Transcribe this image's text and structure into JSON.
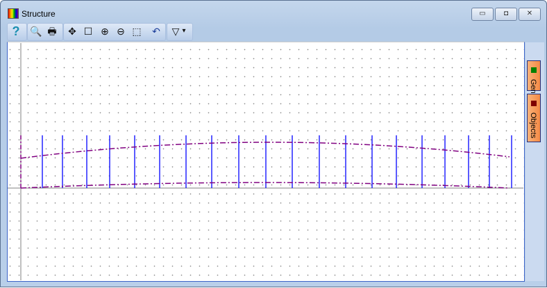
{
  "window": {
    "title": "Structure",
    "minimize": "▭",
    "maximize": "◘",
    "close": "✕"
  },
  "toolbar": {
    "help": "?",
    "preview": "🔍",
    "print": "🖶",
    "pan": "✥",
    "select": "☐",
    "zoom_in": "⊕",
    "zoom_out": "⊖",
    "zoom_fit": "⬚",
    "undo_view": "↶",
    "filter": "▽",
    "filter_arrow": "▾"
  },
  "tabs": [
    {
      "label": "General",
      "color": "#008000"
    },
    {
      "label": "Objects",
      "color": "#800000"
    }
  ],
  "colors": {
    "members": "#0000ff",
    "chords": "#800080",
    "axis": "#808080"
  }
}
